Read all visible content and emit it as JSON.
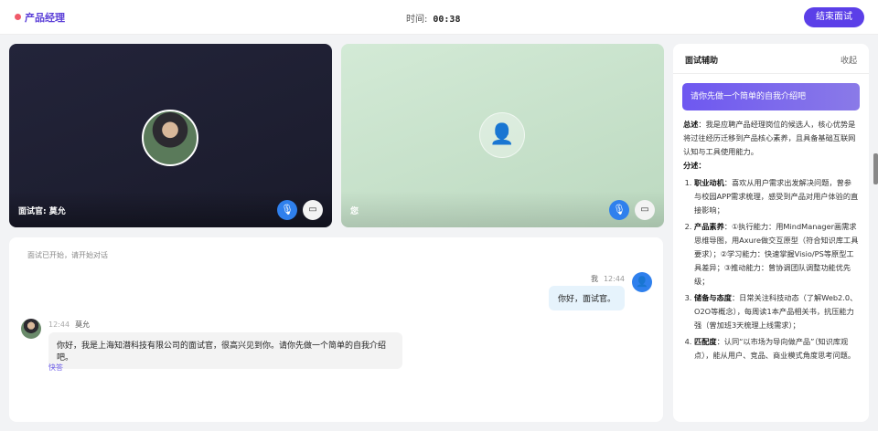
{
  "header": {
    "role": "产品经理",
    "timer_label": "时间:",
    "timer_value": "00:38",
    "end_button": "结束面试"
  },
  "videos": [
    {
      "name": "面试官: 莫允",
      "mic": "mic-icon",
      "cam": "camera-icon"
    },
    {
      "name": "您",
      "mic": "mic-icon",
      "cam": "camera-icon"
    }
  ],
  "chat": {
    "system": "面试已开始，请开始对话",
    "me": {
      "name": "我",
      "time": "12:44",
      "text": "你好，面试官。"
    },
    "interviewer": {
      "time": "12:44",
      "name": "莫允",
      "text": "你好，我是上海知潜科技有限公司的面试官，很高兴见到你。请你先做一个简单的自我介绍吧。"
    },
    "quick_reply": "快答"
  },
  "assist": {
    "title": "面试辅助",
    "collapse": "收起",
    "question": "请你先做一个简单的自我介绍吧",
    "summary_label": "总述",
    "summary": "：我是应聘产品经理岗位的候选人，核心优势是将过往经历迁移到产品核心素养，且具备基础互联网认知与工具使用能力。",
    "detail_label": "分述：",
    "points": [
      {
        "label": "职业动机",
        "text": "：喜欢从用户需求出发解决问题，曾参与校园APP需求梳理，感受到产品对用户体验的直接影响；"
      },
      {
        "label": "产品素养",
        "text": "：①执行能力：用MindManager画需求思维导图，用Axure做交互原型（符合知识库工具要求）；②学习能力：快速掌握Visio/PS等原型工具差异；③推动能力：曾协调团队调整功能优先级；"
      },
      {
        "label": "储备与态度",
        "text": "：日常关注科技动态（了解Web2.0、O2O等概念），每周读1本产品相关书，抗压能力强（曾加班3天梳理上线需求）；"
      },
      {
        "label": "匹配度",
        "text": "：认同“以市场为导向做产品”（知识库观点），能从用户、竞品、商业模式角度思考问题。"
      }
    ]
  }
}
